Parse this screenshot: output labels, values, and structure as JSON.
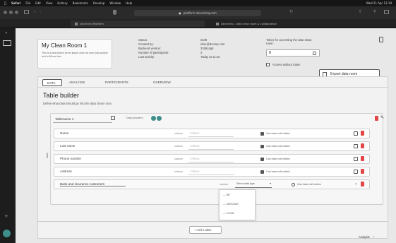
{
  "menubar": {
    "items": [
      "Safari",
      "File",
      "Edit",
      "View",
      "History",
      "Bookmarks",
      "Develop",
      "Window",
      "Help"
    ],
    "right": [
      "Wed 21 Apr 13:19"
    ]
  },
  "browser": {
    "url": "platform.decentriq.com",
    "tabs": [
      "Decentriq Platform",
      "Decentriq - data clean room & collaboration"
    ]
  },
  "room": {
    "title": "My Clean Room 1",
    "description": "This is a description lorem ipsum dolor sit amet just sample text to fill one box",
    "status_label": "Status:",
    "created_label": "Created by:",
    "backend_label": "Backend version:",
    "participants_label": "Number of participants:",
    "activity_label": "Last activity:",
    "status_value": "Draft",
    "created_value": "elise@dcomp.com",
    "backend_value": "31b8c4g6",
    "participants_value": "2",
    "activity_value": "Today at 11:33",
    "token_label": "Token for accessing the data clean room:",
    "token_value": "8",
    "access_label": "Access without token",
    "export_label": "Export data room"
  },
  "tabs": [
    "DATA",
    "ANALYSIS",
    "PARTICIPANTS",
    "OVERVIEW"
  ],
  "table_builder": {
    "title": "Table builder",
    "subtitle": "Define what data should go into the data clean room.",
    "table_name": "Tablename 1",
    "data_provider_label": "Data providers",
    "columns": [
      {
        "name": "Name",
        "type_label": "column",
        "type_value": "STRING",
        "null_label": "Can have null entries"
      },
      {
        "name": "Last name",
        "type_label": "column",
        "type_value": "STRING",
        "null_label": "Can have null entries"
      },
      {
        "name": "Phone number",
        "type_label": "column",
        "type_value": "STRING",
        "null_label": "Can have null entries"
      },
      {
        "name": "Address",
        "type_label": "column",
        "type_value": "STRING",
        "null_label": "Can have null entries"
      }
    ],
    "new_column": {
      "name": "Bank and insurance customers",
      "type_label": "column",
      "select_placeholder": "Select data type",
      "null_label": "Can have null entries",
      "options": [
        "INT",
        "VARCHAR",
        "FLOAT"
      ]
    },
    "add_table_label": "+ Add a table",
    "next_label": "Analysis"
  }
}
